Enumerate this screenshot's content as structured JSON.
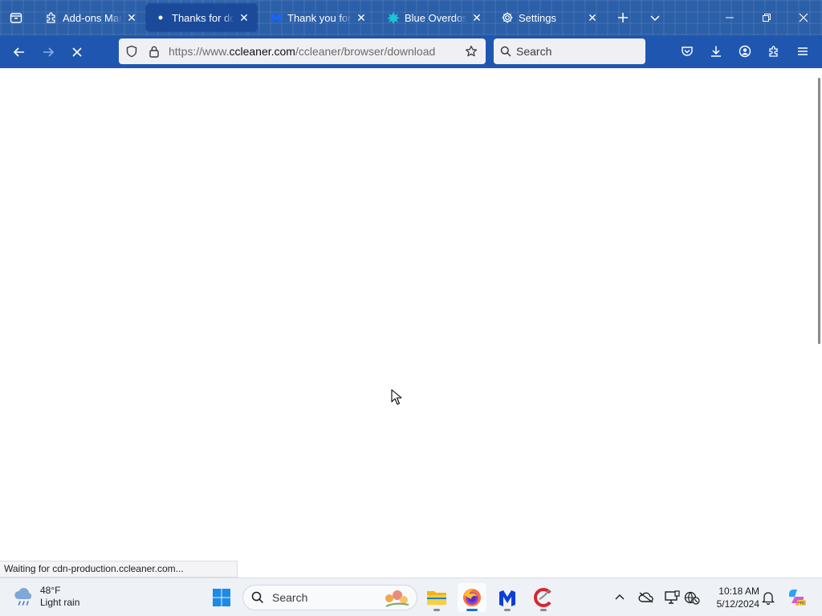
{
  "tabs": [
    {
      "title": "Add-ons Manager",
      "icon": "puzzle-icon",
      "active": false
    },
    {
      "title": "Thanks for downloading",
      "icon": "dot-icon",
      "active": true
    },
    {
      "title": "Thank you for downloading",
      "icon": "malwarebytes-icon",
      "active": false
    },
    {
      "title": "Blue Overdose",
      "icon": "blue-overdose-icon",
      "active": false
    },
    {
      "title": "Settings",
      "icon": "gear-icon",
      "active": false
    }
  ],
  "url": {
    "prefix": "https://www.",
    "host": "ccleaner.com",
    "path": "/ccleaner/browser/download"
  },
  "search": {
    "placeholder": "Search"
  },
  "status_text": "Waiting for cdn-production.ccleaner.com...",
  "taskbar": {
    "weather_temp": "48°F",
    "weather_desc": "Light rain",
    "search_placeholder": "Search",
    "time": "10:18 AM",
    "date": "5/12/2024"
  },
  "colors": {
    "tab_strip": "#2b5fa8",
    "toolbar": "#1f57b0",
    "active_tab": "#1b4a9a"
  }
}
